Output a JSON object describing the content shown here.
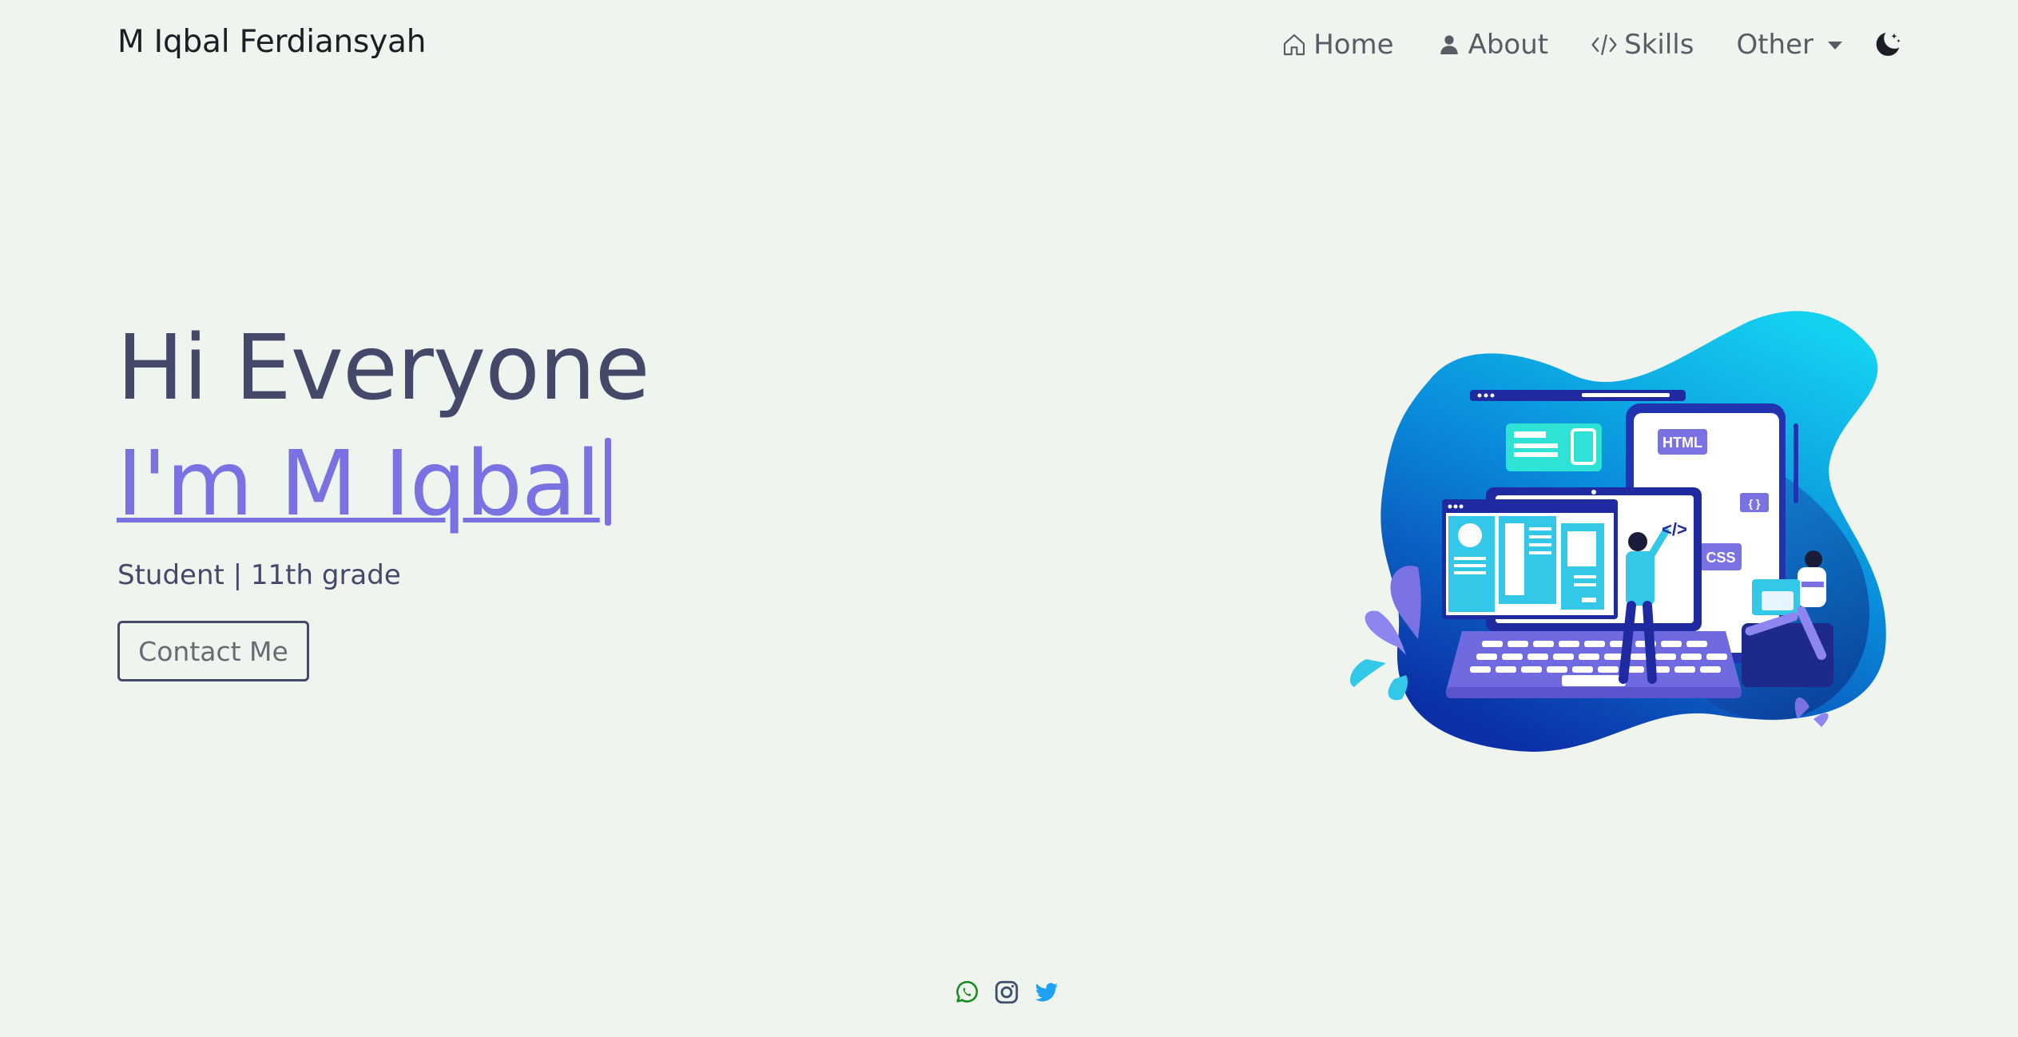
{
  "navbar": {
    "brand": "M Iqbal Ferdiansyah",
    "items": [
      {
        "label": "Home",
        "icon": "home-icon"
      },
      {
        "label": "About",
        "icon": "user-icon"
      },
      {
        "label": "Skills",
        "icon": "code-icon"
      },
      {
        "label": "Other",
        "icon": "chevron-down-icon"
      }
    ],
    "theme_toggle_icon": "moon-stars-icon"
  },
  "hero": {
    "greeting": "Hi Everyone",
    "name": "I'm M Iqbal",
    "subtitle": "Student | 11th grade",
    "cta_label": "Contact Me"
  },
  "illustration": {
    "labels": {
      "html": "HTML",
      "css": "CSS",
      "braces": "{ }",
      "tag": "</>"
    }
  },
  "social": [
    {
      "icon": "whatsapp-icon",
      "color": "#128c1e"
    },
    {
      "icon": "instagram-icon",
      "color": "#3d4f6b"
    },
    {
      "icon": "twitter-icon",
      "color": "#1da1f2"
    }
  ],
  "colors": {
    "background": "#eff5ee",
    "text": "#444869",
    "accent": "#7a72e3"
  }
}
